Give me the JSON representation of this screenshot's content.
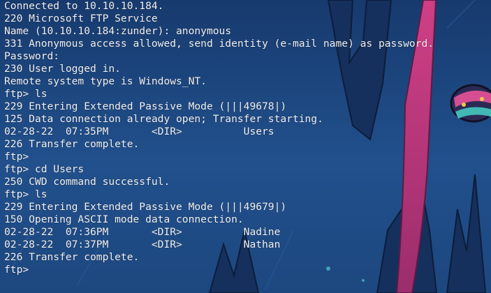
{
  "terminal": {
    "lines": [
      "Connected to 10.10.10.184.",
      "220 Microsoft FTP Service",
      "Name (10.10.10.184:zunder): anonymous",
      "331 Anonymous access allowed, send identity (e-mail name) as password.",
      "Password:",
      "230 User logged in.",
      "Remote system type is Windows_NT.",
      "ftp> ls",
      "229 Entering Extended Passive Mode (|||49678|)",
      "125 Data connection already open; Transfer starting.",
      "02-28-22  07:35PM       <DIR>          Users",
      "226 Transfer complete.",
      "ftp>",
      "ftp> cd Users",
      "250 CWD command successful.",
      "ftp> ls",
      "229 Entering Extended Passive Mode (|||49679|)",
      "150 Opening ASCII mode data connection.",
      "02-28-22  07:36PM       <DIR>          Nadine",
      "02-28-22  07:37PM       <DIR>          Nathan",
      "226 Transfer complete.",
      "ftp>"
    ]
  },
  "colors": {
    "background": "#1f4c86",
    "text": "#f2f2f2",
    "accent_pink": "#c4387e",
    "accent_teal": "#3fb6b4"
  }
}
